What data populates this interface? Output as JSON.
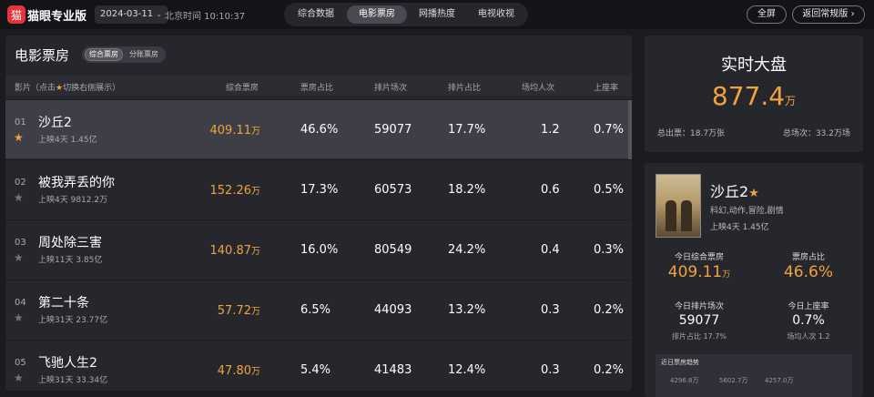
{
  "topbar": {
    "logo_glyph": "猫",
    "brand": "猫眼专业版",
    "date": "2024-03-11",
    "clock": "北京时间 10:10:37",
    "tabs": [
      "综合数据",
      "电影票房",
      "网播热度",
      "电视收视"
    ],
    "active_tab": 1,
    "fullscreen": "全屏",
    "back": "返回常规版"
  },
  "left": {
    "title": "电影票房",
    "seg": [
      "综合票房",
      "分账票房"
    ],
    "headers": {
      "film": "影片（点击",
      "film_star": "★",
      "film_rest": "切换右侧展示）",
      "box": "综合票房",
      "box_share": "票房占比",
      "sessions": "排片场次",
      "session_share": "排片占比",
      "avg": "场均人次",
      "occupancy": "上座率"
    },
    "rows": [
      {
        "rank": "01",
        "name": "沙丘2",
        "sub": "上映4天  1.45亿",
        "box": "409.11",
        "unit": "万",
        "share": "46.6%",
        "sessions": "59077",
        "ss": "17.7%",
        "avg": "1.2",
        "occ": "0.7%"
      },
      {
        "rank": "02",
        "name": "被我弄丢的你",
        "sub": "上映4天  9812.2万",
        "box": "152.26",
        "unit": "万",
        "share": "17.3%",
        "sessions": "60573",
        "ss": "18.2%",
        "avg": "0.6",
        "occ": "0.5%"
      },
      {
        "rank": "03",
        "name": "周处除三害",
        "sub": "上映11天  3.85亿",
        "box": "140.87",
        "unit": "万",
        "share": "16.0%",
        "sessions": "80549",
        "ss": "24.2%",
        "avg": "0.4",
        "occ": "0.3%"
      },
      {
        "rank": "04",
        "name": "第二十条",
        "sub": "上映31天  23.77亿",
        "box": "57.72",
        "unit": "万",
        "share": "6.5%",
        "sessions": "44093",
        "ss": "13.2%",
        "avg": "0.3",
        "occ": "0.2%"
      },
      {
        "rank": "05",
        "name": "飞驰人生2",
        "sub": "上映31天  33.34亿",
        "box": "47.80",
        "unit": "万",
        "share": "5.4%",
        "sessions": "41483",
        "ss": "12.4%",
        "avg": "0.3",
        "occ": "0.2%"
      }
    ]
  },
  "realtime": {
    "title": "实时大盘",
    "total": "877.4",
    "unit": "万",
    "tickets": "总出票：18.7万张",
    "sessions": "总场次：33.2万场"
  },
  "detail": {
    "title": "沙丘2",
    "genre": "科幻,动作,冒险,剧情",
    "sub": "上映4天  1.45亿",
    "box_label": "今日综合票房",
    "box_value": "409.11",
    "box_unit": "万",
    "share_label": "票房占比",
    "share_value": "46.6%",
    "sessions_label": "今日排片场次",
    "sessions_value": "59077",
    "sessions_sub": "排片占比 17.7%",
    "occ_label": "今日上座率",
    "occ_value": "0.7%",
    "occ_sub": "场均人次 1.2",
    "trend_title": "近日票房趋势",
    "trend_vals": [
      "4296.8万",
      "5602.7万",
      "4257.0万"
    ]
  },
  "colors": {
    "accent": "#f1a33c",
    "brand_red": "#e5343a"
  }
}
